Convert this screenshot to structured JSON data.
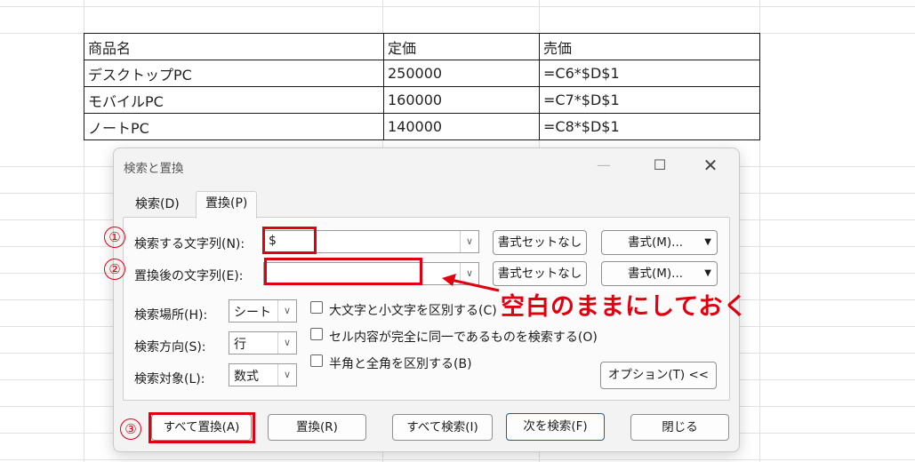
{
  "sheet": {
    "rows": [
      [
        "商品名",
        "定価",
        "売価"
      ],
      [
        "デスクトップPC",
        "250000",
        "=C6*$D$1"
      ],
      [
        "モバイルPC",
        "160000",
        "=C7*$D$1"
      ],
      [
        "ノートPC",
        "140000",
        "=C8*$D$1"
      ]
    ]
  },
  "dialog": {
    "title": "検索と置換",
    "window_controls": {
      "minimize": "—",
      "maximize": "☐",
      "close": "✕"
    },
    "tabs": [
      {
        "label": "検索(D)"
      },
      {
        "label": "置換(P)"
      }
    ],
    "find_label": "検索する文字列(N):",
    "find_value": "$",
    "replace_label": "置換後の文字列(E):",
    "replace_value": "",
    "no_format_label": "書式セットなし",
    "format_button": "書式(M)...",
    "within_label": "検索場所(H):",
    "within_value": "シート",
    "search_label": "検索方向(S):",
    "search_value": "行",
    "lookin_label": "検索対象(L):",
    "lookin_value": "数式",
    "match_case": "大文字と小文字を区別する(C)",
    "match_entire": "セル内容が完全に同一であるものを検索する(O)",
    "match_byte": "半角と全角を区別する(B)",
    "options_button": "オプション(T) <<",
    "buttons": {
      "replace_all": "すべて置換(A)",
      "replace": "置換(R)",
      "find_all": "すべて検索(I)",
      "find_next": "次を検索(F)",
      "close": "閉じる"
    }
  },
  "annotations": {
    "n1": "①",
    "n2": "②",
    "n3": "③",
    "note": "空白のままにしておく",
    "colors": {
      "accent": "#e0000f"
    }
  }
}
